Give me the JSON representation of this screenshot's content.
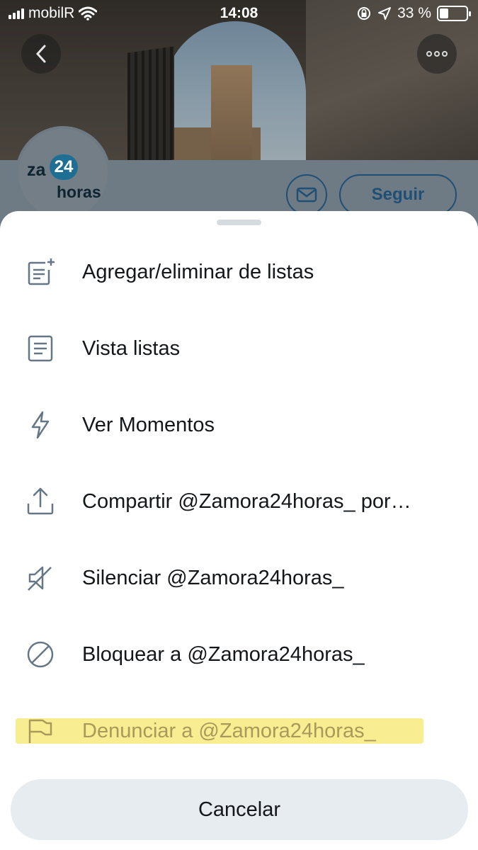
{
  "status_bar": {
    "carrier": "mobilR",
    "time": "14:08",
    "battery": "33 %",
    "battery_level": 0.33
  },
  "profile": {
    "avatar_text_za": "za",
    "avatar_text_24": "24",
    "avatar_text_horas": "horas",
    "follow_label": "Seguir"
  },
  "menu": {
    "items": [
      {
        "label": "Agregar/eliminar de listas",
        "icon": "list-add-icon"
      },
      {
        "label": "Vista listas",
        "icon": "list-icon"
      },
      {
        "label": "Ver Momentos",
        "icon": "lightning-icon"
      },
      {
        "label": "Compartir @Zamora24horas_ por…",
        "icon": "share-icon"
      },
      {
        "label": "Silenciar @Zamora24horas_",
        "icon": "mute-icon"
      },
      {
        "label": "Bloquear a @Zamora24horas_",
        "icon": "block-icon"
      },
      {
        "label": "Denunciar a @Zamora24horas_",
        "icon": "flag-icon"
      }
    ],
    "cancel_label": "Cancelar"
  },
  "colors": {
    "accent": "#1da1f2",
    "text": "#14171a",
    "icon": "#657786",
    "highlight": "#f9ec8c"
  }
}
